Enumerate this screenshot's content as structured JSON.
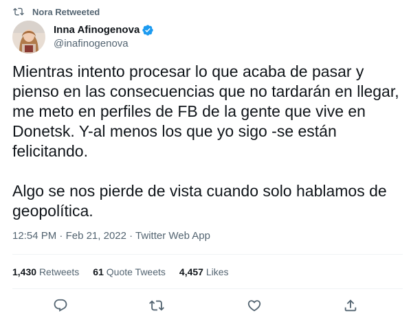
{
  "retweet": {
    "label": "Nora Retweeted",
    "icon": "retweet-icon"
  },
  "author": {
    "name": "Inna Afinogenova",
    "handle": "@inafinogenova",
    "verified_icon": "verified-badge-icon",
    "verified_color": "#1d9bf0"
  },
  "tweet": {
    "paragraphs": [
      "Mientras intento procesar lo que acaba de pasar y pienso en las consecuencias que no tardarán en llegar, me meto en perfiles de FB de la gente que vive en Donetsk. Y-al menos los que yo sigo -se están felicitando.",
      "Algo se nos pierde de vista cuando solo hablamos de geopolítica."
    ]
  },
  "meta": {
    "time": "12:54 PM",
    "separator1": " · ",
    "date": "Feb 21, 2022",
    "separator2": " · ",
    "source": "Twitter Web App"
  },
  "stats": {
    "retweets_count": "1,430",
    "retweets_label": "Retweets",
    "quotes_count": "61",
    "quotes_label": "Quote Tweets",
    "likes_count": "4,457",
    "likes_label": "Likes"
  },
  "actions": {
    "reply_icon": "reply-icon",
    "retweet_icon": "retweet-icon",
    "like_icon": "heart-icon",
    "share_icon": "share-icon"
  },
  "colors": {
    "text": "#0f1419",
    "secondary": "#536471",
    "divider": "#eff3f4"
  }
}
